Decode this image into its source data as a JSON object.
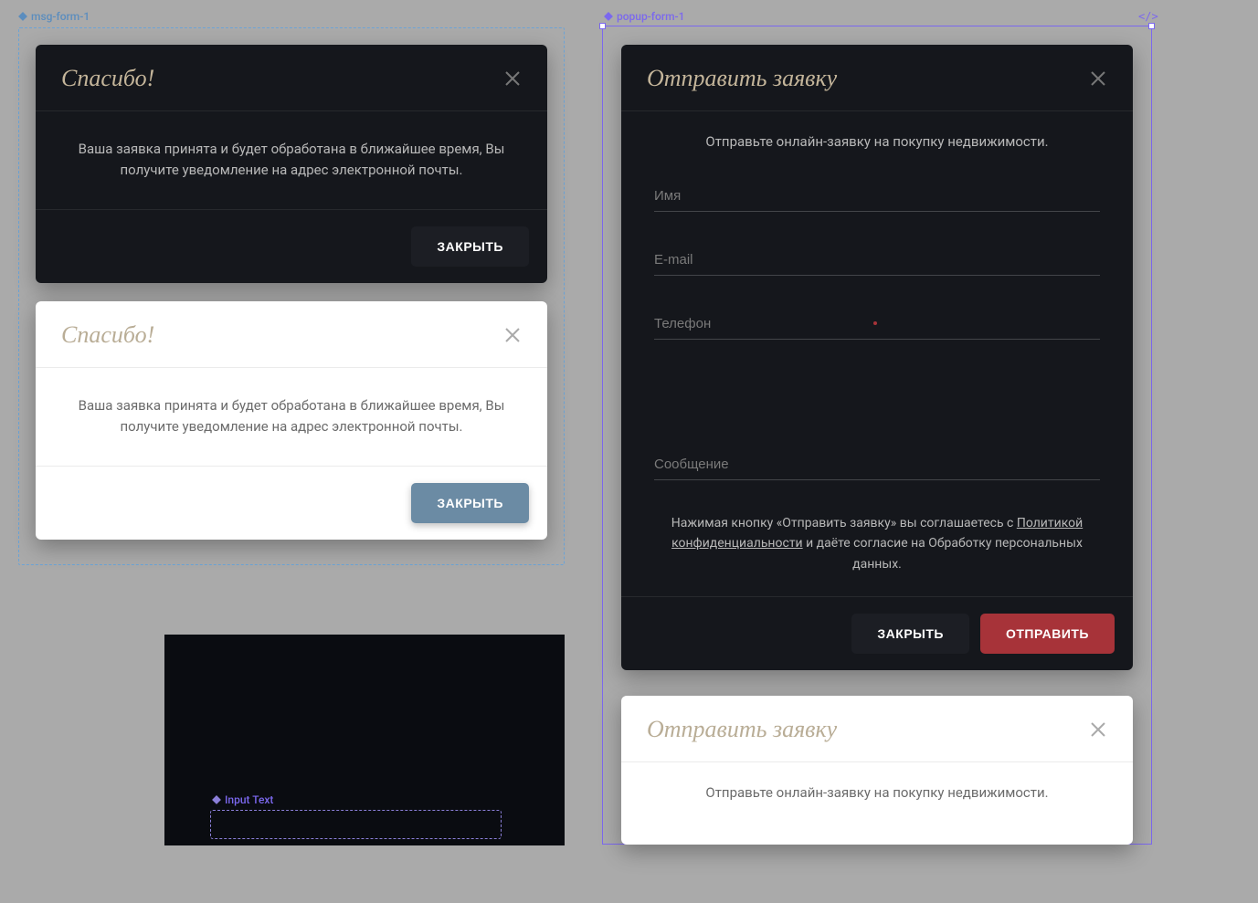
{
  "labels": {
    "msg_form": "msg-form-1",
    "popup_form": "popup-form-1",
    "input_text": "Input Text"
  },
  "thanks": {
    "title": "Спасибо!",
    "body": "Ваша заявка принята и будет обработана в ближайшее время, Вы получите уведомление на адрес электронной почты.",
    "close_btn": "ЗАКРЫТЬ"
  },
  "form": {
    "title": "Отправить заявку",
    "intro": "Отправьте онлайн-заявку на покупку недвижимости.",
    "placeholders": {
      "name": "Имя",
      "email": "E-mail",
      "phone": "Телефон",
      "message": "Сообщение"
    },
    "consent_pre": "Нажимая кнопку «Отправить заявку» вы соглашаетесь с ",
    "consent_link": "Политикой конфиденциальности",
    "consent_post": " и даёте согласие на Обработку персональных данных.",
    "close_btn": "ЗАКРЫТЬ",
    "submit_btn": "ОТПРАВИТЬ"
  },
  "colors": {
    "accent_gold": "#C4B59A",
    "accent_red": "#A73339",
    "accent_blue": "#6B8BA4",
    "purple": "#7B68EE"
  }
}
